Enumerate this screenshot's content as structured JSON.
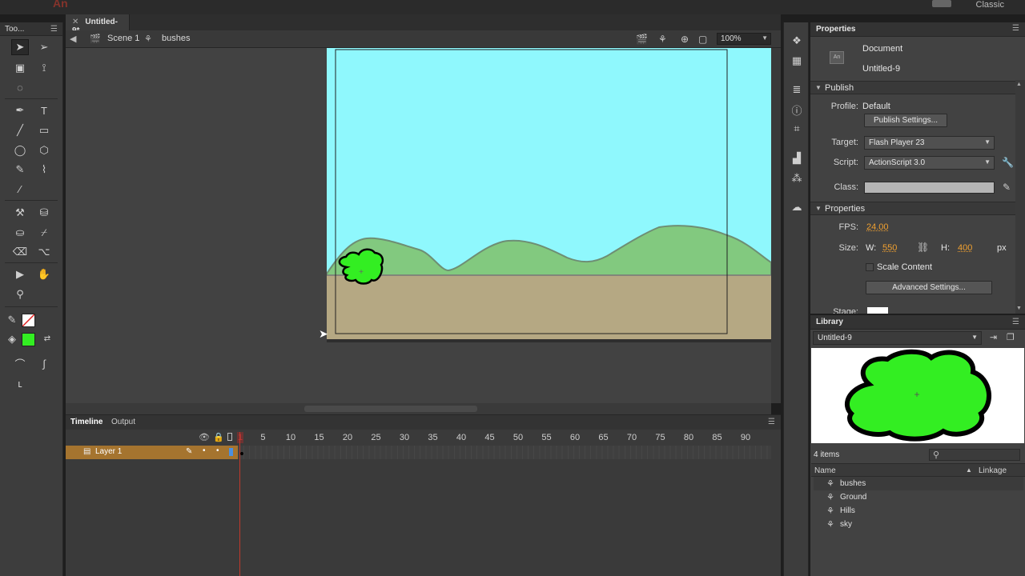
{
  "app": {
    "logo": "An",
    "workspace": "Classic"
  },
  "tools_panel": {
    "title": "Too..."
  },
  "document": {
    "tab_title": "Untitled-9*",
    "breadcrumb": [
      "Scene 1",
      "bushes"
    ],
    "zoom": "100%"
  },
  "timeline": {
    "tabs": [
      "Timeline",
      "Output"
    ],
    "ticks": [
      "1",
      "5",
      "10",
      "15",
      "20",
      "25",
      "30",
      "35",
      "40",
      "45",
      "50",
      "55",
      "60",
      "65",
      "70",
      "75",
      "80",
      "85",
      "90"
    ],
    "layer_name": "Layer 1"
  },
  "properties": {
    "title": "Properties",
    "doc_type": "Document",
    "doc_name": "Untitled-9",
    "publish_header": "Publish",
    "profile_label": "Profile:",
    "profile_value": "Default",
    "publish_settings_btn": "Publish Settings...",
    "target_label": "Target:",
    "target_value": "Flash Player 23",
    "script_label": "Script:",
    "script_value": "ActionScript 3.0",
    "class_label": "Class:",
    "class_value": "",
    "properties_header": "Properties",
    "fps_label": "FPS:",
    "fps_value": "24.00",
    "size_label": "Size:",
    "w_label": "W:",
    "w_value": "550",
    "h_label": "H:",
    "h_value": "400",
    "unit": "px",
    "scale_content": "Scale Content",
    "advanced_btn": "Advanced Settings...",
    "stage_label": "Stage:"
  },
  "library": {
    "title": "Library",
    "document": "Untitled-9",
    "item_count": "4 items",
    "col_name": "Name",
    "col_linkage": "Linkage",
    "items": [
      "bushes",
      "Ground",
      "Hills",
      "sky"
    ]
  },
  "colors": {
    "sky": "#8ff8fd",
    "hills": "#82c97f",
    "ground": "#b5a883",
    "bush": "#33ee22",
    "layer_highlight": "#a5742f",
    "playhead": "#c0392b",
    "fill_swatch": "#33ee22"
  }
}
